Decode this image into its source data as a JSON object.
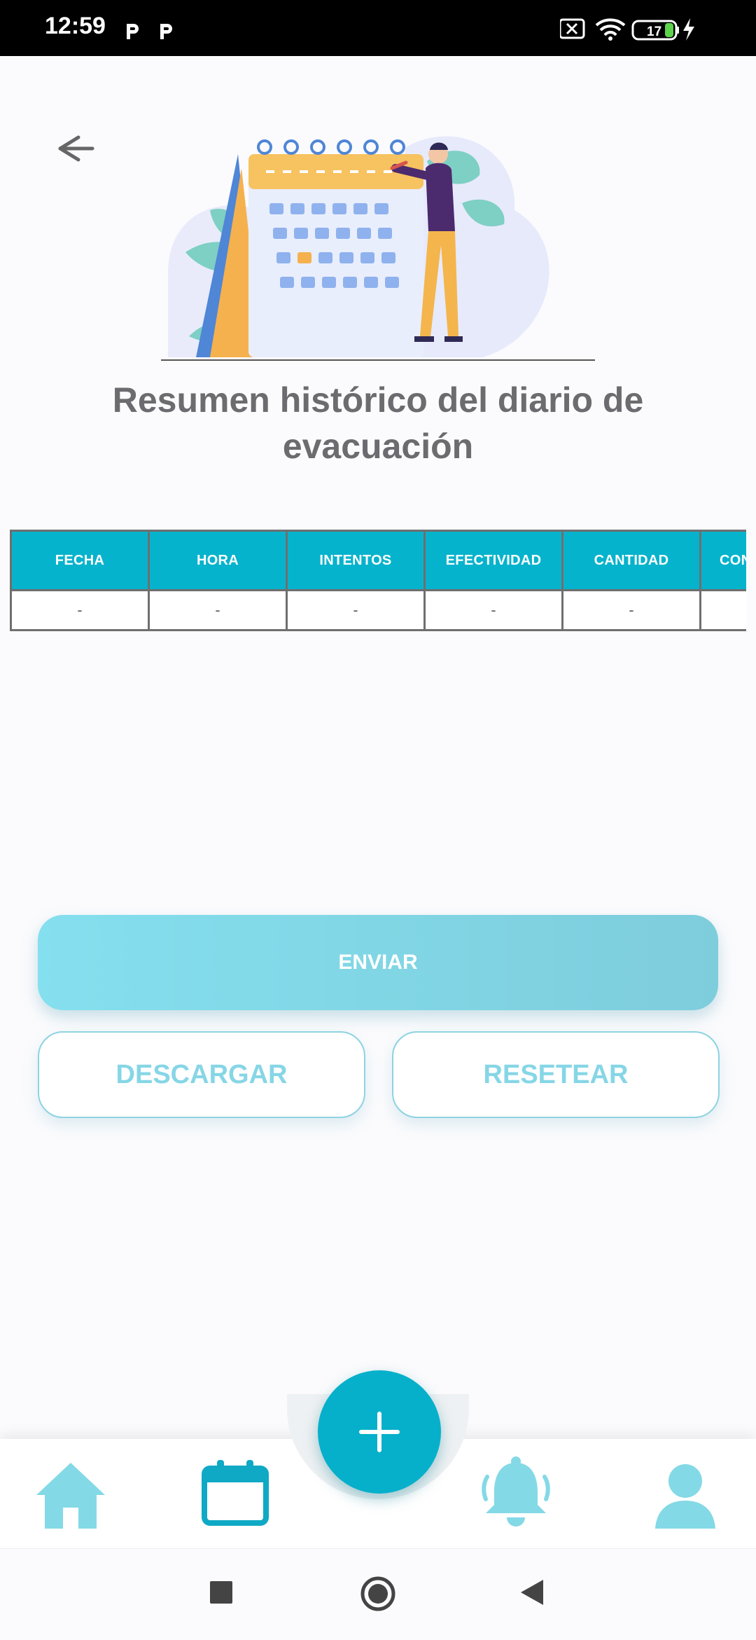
{
  "status_bar": {
    "time": "12:59",
    "battery": "17",
    "icons": [
      "parking-icon",
      "parking-icon",
      "no-sim-icon",
      "wifi-icon",
      "battery-icon",
      "charging-icon"
    ]
  },
  "header": {
    "title": "Resumen histórico del diario de evacuación",
    "back_icon": "back-arrow-icon"
  },
  "table": {
    "columns": [
      "FECHA",
      "HORA",
      "INTENTOS",
      "EFECTIVIDAD",
      "CANTIDAD",
      "CONSI"
    ],
    "rows": [
      [
        "-",
        "-",
        "-",
        "-",
        "-",
        ""
      ]
    ]
  },
  "actions": {
    "send_label": "ENVIAR",
    "download_label": "DESCARGAR",
    "reset_label": "RESETEAR"
  },
  "bottom_nav": {
    "items": [
      "home-icon",
      "calendar-icon",
      "plus-icon",
      "bell-icon",
      "user-icon"
    ]
  },
  "colors": {
    "accent": "#06b3cc",
    "button_light": "#84dfee",
    "nav_icon": "#84d9e6"
  }
}
